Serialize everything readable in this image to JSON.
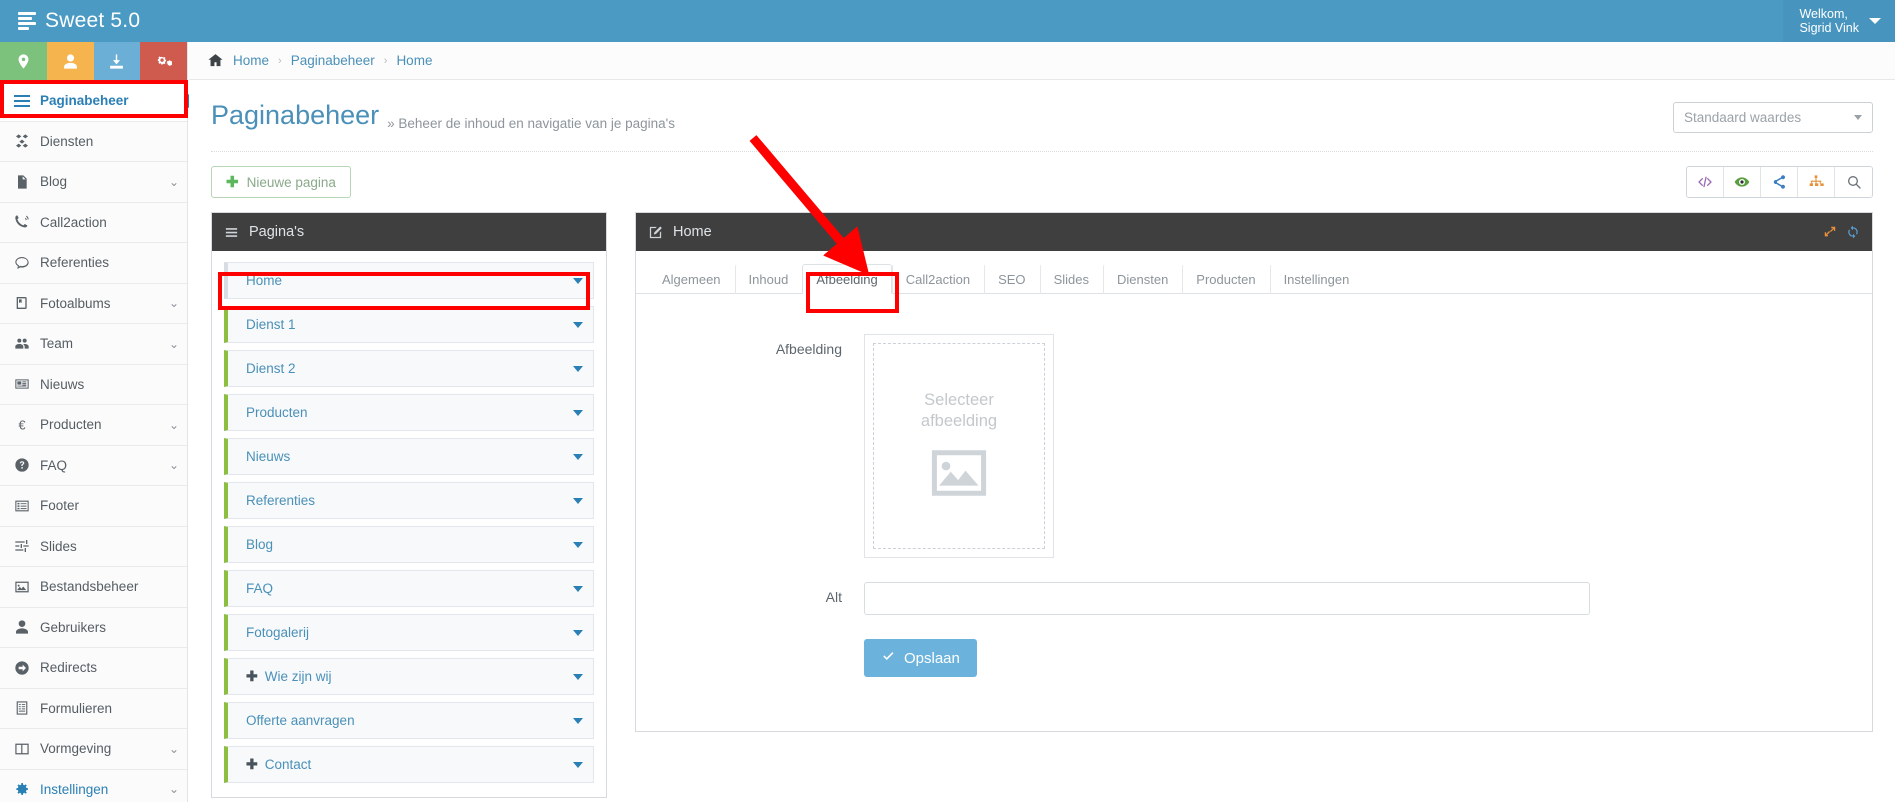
{
  "topbar": {
    "brand": "Sweet 5.0",
    "brand_icon": "server-stack-icon",
    "user_greeting": "Welkom,",
    "user_name": "Sigrid Vink"
  },
  "quick_actions": [
    {
      "name": "location-pin-icon",
      "color": "#7cc27c"
    },
    {
      "name": "user-icon",
      "color": "#f5b44d"
    },
    {
      "name": "download-icon",
      "color": "#6bafd6"
    },
    {
      "name": "cogs-icon",
      "color": "#cf5b4e"
    }
  ],
  "sidebar": {
    "items": [
      {
        "label": "Paginabeheer",
        "icon": "hamburger-icon",
        "chevron": false,
        "active": true
      },
      {
        "label": "Diensten",
        "icon": "boxes-icon",
        "chevron": false,
        "active": false
      },
      {
        "label": "Blog",
        "icon": "file-text-icon",
        "chevron": true,
        "active": false
      },
      {
        "label": "Call2action",
        "icon": "phone-volume-icon",
        "chevron": false,
        "active": false
      },
      {
        "label": "Referenties",
        "icon": "comment-icon",
        "chevron": false,
        "active": false
      },
      {
        "label": "Fotoalbums",
        "icon": "book-icon",
        "chevron": true,
        "active": false
      },
      {
        "label": "Team",
        "icon": "users-icon",
        "chevron": true,
        "active": false
      },
      {
        "label": "Nieuws",
        "icon": "newspaper-icon",
        "chevron": false,
        "active": false
      },
      {
        "label": "Producten",
        "icon": "euro-icon",
        "chevron": true,
        "active": false
      },
      {
        "label": "FAQ",
        "icon": "question-circle-icon",
        "chevron": true,
        "active": false
      },
      {
        "label": "Footer",
        "icon": "list-alt-icon",
        "chevron": false,
        "active": false
      },
      {
        "label": "Slides",
        "icon": "sliders-icon",
        "chevron": false,
        "active": false
      },
      {
        "label": "Bestandsbeheer",
        "icon": "image-icon",
        "chevron": false,
        "active": false
      },
      {
        "label": "Gebruikers",
        "icon": "user-icon",
        "chevron": false,
        "active": false
      },
      {
        "label": "Redirects",
        "icon": "arrow-circle-right-icon",
        "chevron": false,
        "active": false
      },
      {
        "label": "Formulieren",
        "icon": "form-icon",
        "chevron": false,
        "active": false
      },
      {
        "label": "Vormgeving",
        "icon": "columns-icon",
        "chevron": true,
        "active": false
      },
      {
        "label": "Instellingen",
        "icon": "gear-icon",
        "chevron": true,
        "active": false
      }
    ]
  },
  "breadcrumb": {
    "home_icon": "home-icon",
    "items": [
      "Home",
      "Paginabeheer",
      "Home"
    ],
    "separator": "›"
  },
  "page_header": {
    "title": "Paginabeheer",
    "subtitle": "» Beheer de inhoud en navigatie van je pagina's",
    "preset_select": "Standaard waardes"
  },
  "toolbar": {
    "new_page_label": "Nieuwe pagina",
    "new_page_icon": "plus-icon",
    "icons": [
      {
        "name": "code-icon",
        "color": "#9b6bb3"
      },
      {
        "name": "eye-icon",
        "color": "#5a9e3f"
      },
      {
        "name": "share-icon",
        "color": "#3d7fc1"
      },
      {
        "name": "sitemap-icon",
        "color": "#e8903a"
      },
      {
        "name": "search-icon",
        "color": "#6b7278"
      }
    ]
  },
  "pages_panel": {
    "header": "Pagina's",
    "header_icon": "hamburger-icon",
    "rows": [
      {
        "label": "Home",
        "plus": false,
        "highlighted": true
      },
      {
        "label": "Dienst 1",
        "plus": false,
        "highlighted": false
      },
      {
        "label": "Dienst 2",
        "plus": false,
        "highlighted": false
      },
      {
        "label": "Producten",
        "plus": false,
        "highlighted": false
      },
      {
        "label": "Nieuws",
        "plus": false,
        "highlighted": false
      },
      {
        "label": "Referenties",
        "plus": false,
        "highlighted": false
      },
      {
        "label": "Blog",
        "plus": false,
        "highlighted": false
      },
      {
        "label": "FAQ",
        "plus": false,
        "highlighted": false
      },
      {
        "label": "Fotogalerij",
        "plus": false,
        "highlighted": false
      },
      {
        "label": "Wie zijn wij",
        "plus": true,
        "highlighted": false
      },
      {
        "label": "Offerte aanvragen",
        "plus": false,
        "highlighted": false
      },
      {
        "label": "Contact",
        "plus": true,
        "highlighted": false
      }
    ]
  },
  "edit_panel": {
    "header": "Home",
    "header_icon": "edit-pencil-icon",
    "expand_icon": "expand-arrows-icon",
    "refresh_icon": "refresh-icon",
    "tabs": [
      {
        "label": "Algemeen",
        "active": false
      },
      {
        "label": "Inhoud",
        "active": false
      },
      {
        "label": "Afbeelding",
        "active": true
      },
      {
        "label": "Call2action",
        "active": false
      },
      {
        "label": "SEO",
        "active": false
      },
      {
        "label": "Slides",
        "active": false
      },
      {
        "label": "Diensten",
        "active": false
      },
      {
        "label": "Producten",
        "active": false
      },
      {
        "label": "Instellingen",
        "active": false
      }
    ],
    "form": {
      "image_label": "Afbeelding",
      "image_placeholder_line1": "Selecteer",
      "image_placeholder_line2": "afbeelding",
      "image_icon": "picture-placeholder-icon",
      "alt_label": "Alt",
      "alt_value": "",
      "alt_placeholder": "",
      "save_label": "Opslaan",
      "save_icon": "check-icon"
    }
  },
  "annotations": {
    "color": "#ff0000",
    "highlight_paginabeheer": "Paginabeheer sidebar item",
    "highlight_home_row": "Home page row",
    "highlight_afbeelding_tab": "Afbeelding tab",
    "arrow": "red-arrow-pointing-to-afbeelding-tab"
  }
}
